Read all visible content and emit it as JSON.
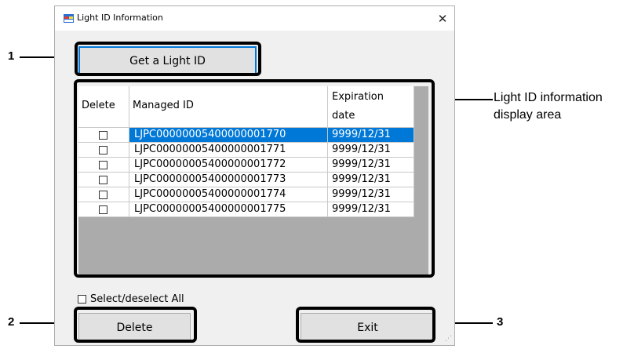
{
  "window": {
    "title": "Light ID Information",
    "close_glyph": "✕"
  },
  "buttons": {
    "get_light_id": "Get a Light ID",
    "delete": "Delete",
    "exit": "Exit"
  },
  "grid": {
    "headers": {
      "delete": "Delete",
      "managed_id": "Managed ID",
      "expiration_line1": "Expiration",
      "expiration_line2": "date"
    },
    "rows": [
      {
        "managed_id": "LJPC00000005400000001770",
        "expiration": "9999/12/31",
        "checked": false,
        "selected": true
      },
      {
        "managed_id": "LJPC00000005400000001771",
        "expiration": "9999/12/31",
        "checked": false,
        "selected": false
      },
      {
        "managed_id": "LJPC00000005400000001772",
        "expiration": "9999/12/31",
        "checked": false,
        "selected": false
      },
      {
        "managed_id": "LJPC00000005400000001773",
        "expiration": "9999/12/31",
        "checked": false,
        "selected": false
      },
      {
        "managed_id": "LJPC00000005400000001774",
        "expiration": "9999/12/31",
        "checked": false,
        "selected": false
      },
      {
        "managed_id": "LJPC00000005400000001775",
        "expiration": "9999/12/31",
        "checked": false,
        "selected": false
      }
    ]
  },
  "select_all_label": "Select/deselect All",
  "annotations": {
    "n1": "1",
    "n2": "2",
    "n3": "3",
    "area_line1": "Light ID information",
    "area_line2": "display area"
  },
  "colors": {
    "selection": "#0078d7",
    "grid_background": "#ababab"
  },
  "icons": {
    "app": "app-window-icon",
    "close": "close-icon",
    "checkbox": "checkbox-unchecked-icon"
  }
}
